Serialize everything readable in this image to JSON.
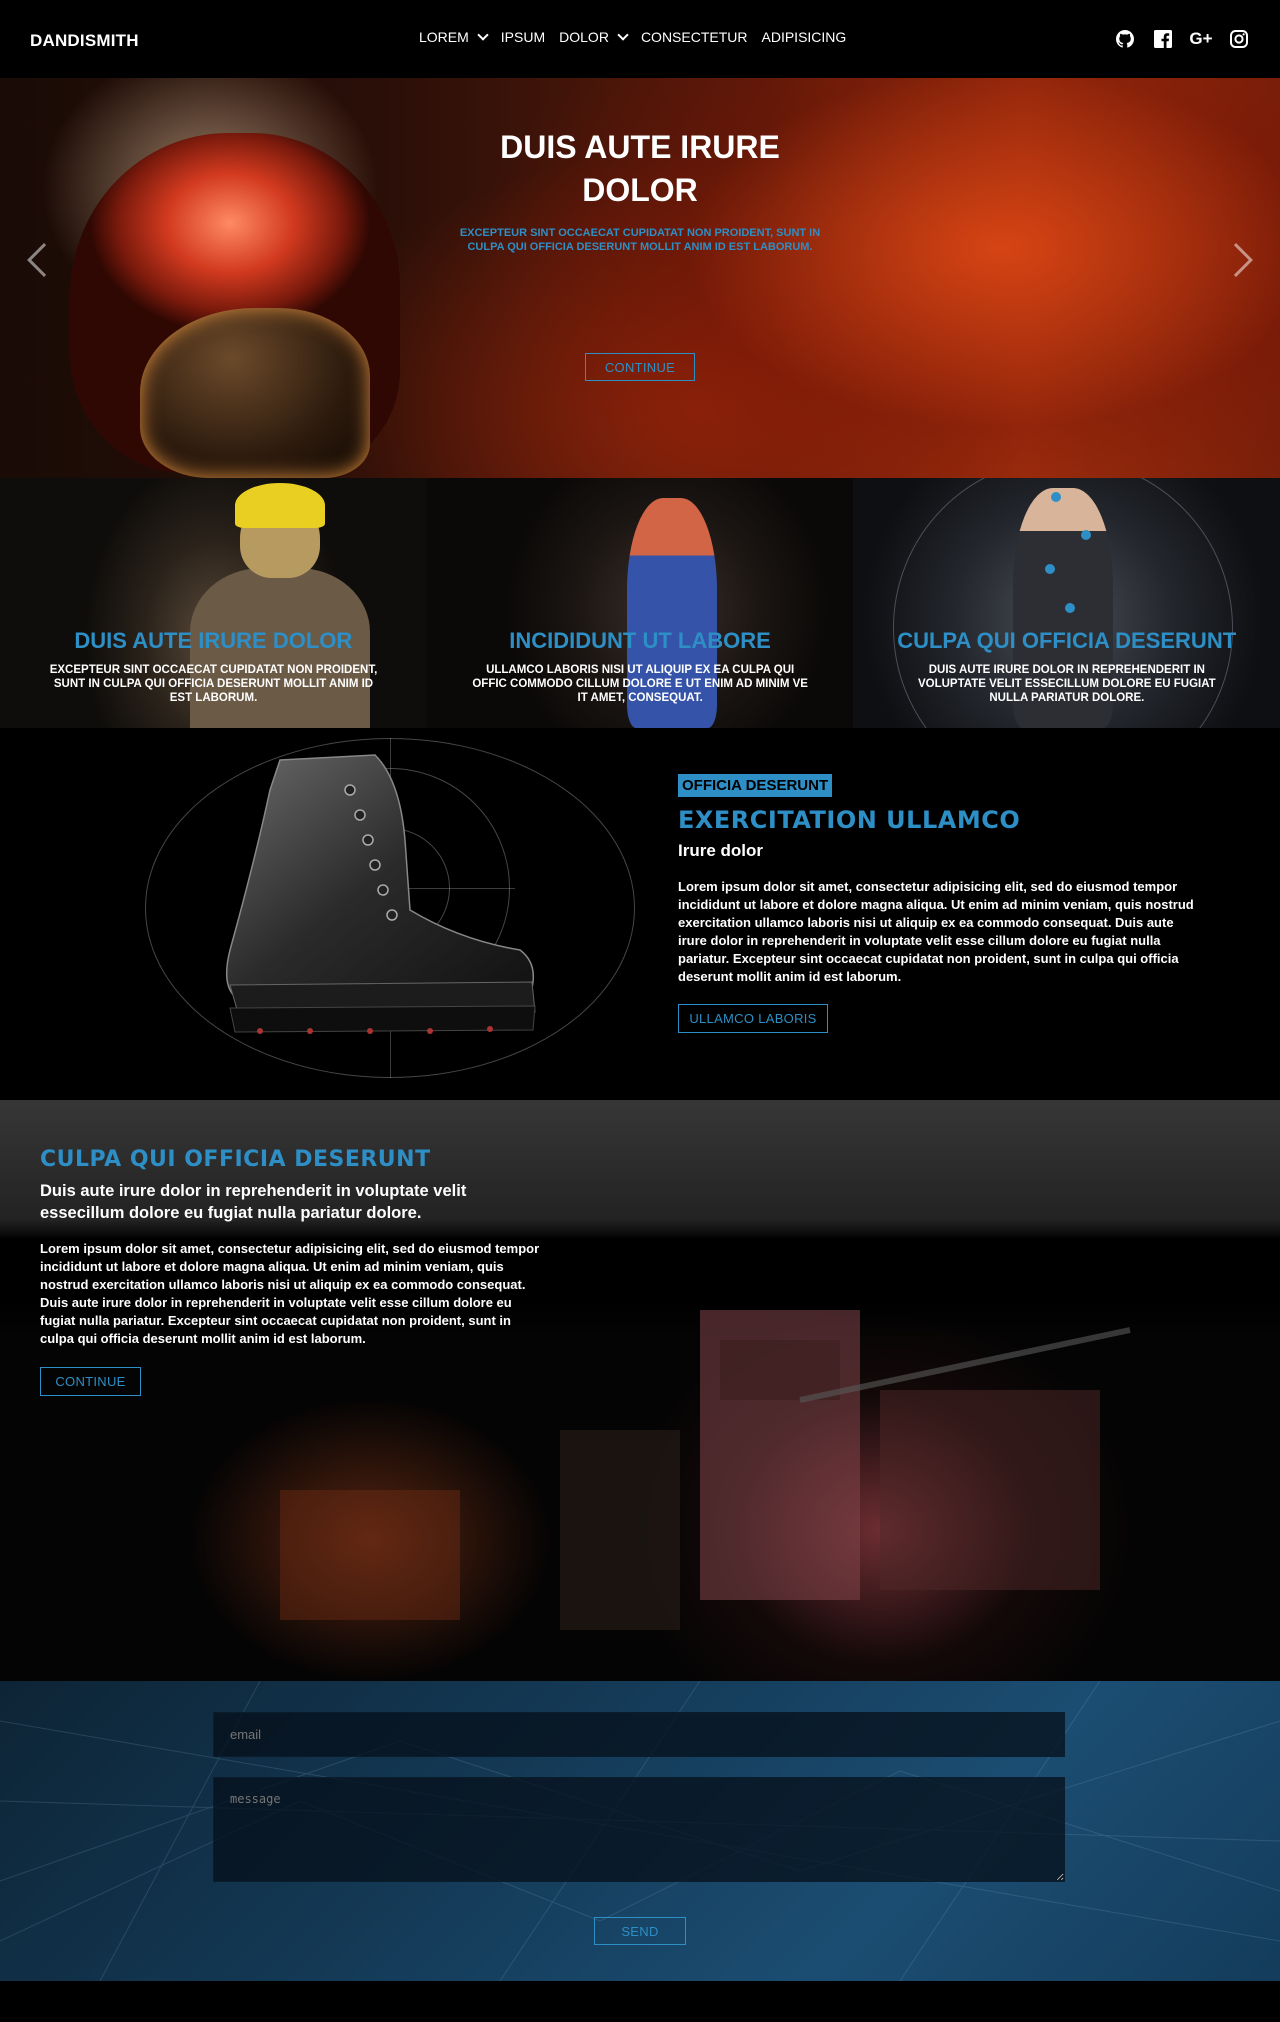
{
  "nav": {
    "brand": "DANDISMITH",
    "items": [
      {
        "label": "LOREM",
        "has_dropdown": true
      },
      {
        "label": "IPSUM",
        "has_dropdown": false
      },
      {
        "label": "DOLOR",
        "has_dropdown": true
      },
      {
        "label": "CONSECTETUR",
        "has_dropdown": false
      },
      {
        "label": "ADIPISICING",
        "has_dropdown": false
      }
    ],
    "socials": [
      "github-icon",
      "facebook-icon",
      "google-plus-icon",
      "instagram-icon"
    ],
    "google_plus_glyph": "G+"
  },
  "hero": {
    "title": "DUIS AUTE IRURE DOLOR",
    "subtitle": "EXCEPTEUR SINT OCCAECAT CUPIDATAT NON PROIDENT, SUNT IN CULPA QUI OFFICIA DESERUNT MOLLIT ANIM ID EST LABORUM.",
    "button": "CONTINUE"
  },
  "panels": [
    {
      "title": "DUIS AUTE IRURE DOLOR",
      "text": "EXCEPTEUR SINT OCCAECAT CUPIDATAT NON PROIDENT, SUNT IN CULPA QUI OFFICIA DESERUNT MOLLIT ANIM ID EST LABORUM."
    },
    {
      "title": "INCIDIDUNT UT LABORE",
      "text": "ULLAMCO LABORIS NISI UT ALIQUIP EX EA CULPA QUI OFFIC COMMODO CILLUM DOLORE E UT ENIM AD MINIM VE IT AMET, CONSEQUAT."
    },
    {
      "title": "CULPA QUI OFFICIA DESERUNT",
      "text": "DUIS AUTE IRURE DOLOR IN REPREHENDERIT IN VOLUPTATE VELIT ESSECILLUM DOLORE EU FUGIAT NULLA PARIATUR DOLORE."
    }
  ],
  "product": {
    "tag": "OFFICIA DESERUNT",
    "title": "EXERCITATION ULLAMCO",
    "subtitle": "Irure dolor",
    "body": "Lorem ipsum dolor sit amet, consectetur adipisicing elit, sed do eiusmod tempor incididunt ut labore et dolore magna aliqua. Ut enim ad minim veniam, quis nostrud exercitation ullamco laboris nisi ut aliquip ex ea commodo consequat. Duis aute irure dolor in reprehenderit in voluptate velit esse cillum dolore eu fugiat nulla pariatur. Excepteur sint occaecat cupidatat non proident, sunt in culpa qui officia deserunt mollit anim id est laborum.",
    "button": "ULLAMCO LABORIS"
  },
  "feature": {
    "title": "CULPA QUI OFFICIA DESERUNT",
    "subtitle": "Duis aute irure dolor in reprehenderit in voluptate velit essecillum dolore eu fugiat nulla pariatur dolore.",
    "body": "Lorem ipsum dolor sit amet, consectetur adipisicing elit, sed do eiusmod tempor incididunt ut labore et dolore magna aliqua. Ut enim ad minim veniam, quis nostrud exercitation ullamco laboris nisi ut aliquip ex ea commodo consequat. Duis aute irure dolor in reprehenderit in voluptate velit esse cillum dolore eu fugiat nulla pariatur. Excepteur sint occaecat cupidatat non proident, sunt in culpa qui officia deserunt mollit anim id est laborum.",
    "button": "CONTINUE"
  },
  "contact": {
    "email_placeholder": "email",
    "message_placeholder": "message",
    "send_label": "SEND"
  },
  "colors": {
    "accent": "#2d8fc6",
    "background": "#000000"
  }
}
